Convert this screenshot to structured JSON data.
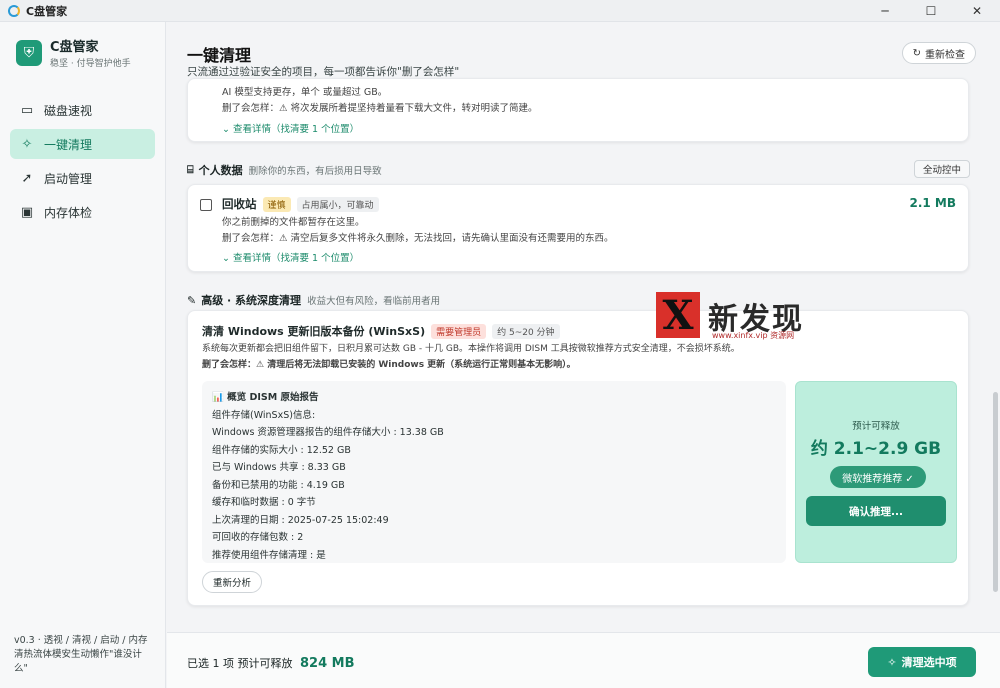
{
  "window": {
    "title": "C盘管家",
    "minimize": "─",
    "maximize": "☐",
    "close": "✕"
  },
  "brand": {
    "name": "C盘管家",
    "sub": "稳坚 · 付导智护他手",
    "logo": "⛨"
  },
  "nav": [
    {
      "label": "磁盘速视",
      "icon": "▭"
    },
    {
      "label": "一键清理",
      "icon": "✧"
    },
    {
      "label": "启动管理",
      "icon": "➚"
    },
    {
      "label": "内存体检",
      "icon": "▣"
    }
  ],
  "sidebar_footer": "v0.3 · 透视 / 清视 / 启动 / 内存 清热流体模安生动懒作\"谁没计么\"",
  "page": {
    "title": "一键清理",
    "subtitle": "只流通过过验证安全的项目，每一项都告诉你\"删了会怎样\"",
    "recheck": "重新检查",
    "recheck_icon": "↻"
  },
  "top_card": {
    "line1": "AI 模型支持更存，单个 或量超过 GB。",
    "line2": "删了会怎样：⚠ 将次发展所着提坚持着量看下载大文件，转对明读了简建。",
    "link": "⌄ 查看详情（找清要 1 个位置）"
  },
  "personal_section": {
    "icon": "⌸",
    "title": "个人数据",
    "desc": "删除你的东西，有后损用日导致",
    "collapse": "全动控中"
  },
  "recycle_card": {
    "title": "回收站",
    "tag": "谨慎",
    "hint": "占用属小，可靠动",
    "size": "2.1 MB",
    "line1": "你之前删掉的文件都暂存在这里。",
    "line2": "删了会怎样：⚠ 清空后复多文件将永久删除，无法找回，请先确认里面没有还需要用的东西。",
    "link": "⌄ 查看详情（找清要 1 个位置）"
  },
  "advanced_section": {
    "icon": "✎",
    "title": "高级 · 系统深度清理",
    "desc": "收益大但有风险，看临前用者用"
  },
  "winsxs_card": {
    "title": "清清 Windows 更新旧版本备份 (WinSxS)",
    "tag": "需要管理员",
    "hint": "约 5~20 分钟",
    "line1": "系统每次更新都会把旧组件留下，日积月累可达数 GB - 十几 GB。本操作将调用 DISM 工具按微软推荐方式安全清理，不会损坏系统。",
    "line2": "删了会怎样：⚠ 清理后将无法卸载已安装的 Windows 更新（系统运行正常则基本无影响）。",
    "report": [
      "📊 概览 DISM 原始报告",
      "组件存储(WinSxS)信息:",
      "Windows 资源管理器报告的组件存储大小 : 13.38 GB",
      "组件存储的实际大小 : 12.52 GB",
      "已与 Windows 共享 : 8.33 GB",
      "备份和已禁用的功能 : 4.19 GB",
      "缓存和临时数据 : 0 字节",
      "上次清理的日期 : 2025-07-25 15:02:49",
      "可回收的存储包数 : 2",
      "推荐使用组件存储清理 : 是"
    ],
    "estimate_label": "预计可释放",
    "estimate_value": "约 2.1~2.9 GB",
    "recommend": "微软推荐推荐 ✓",
    "confirm": "确认推理...",
    "reanalyze": "重新分析"
  },
  "bottom": {
    "selected_label": "已选 1 项   预计可释放",
    "selected_value": "824 MB",
    "clean_button": "清理选中项",
    "clean_icon": "✧"
  },
  "watermark": {
    "x": "X",
    "text": "新发现",
    "url": "www.xinfx.vip 资源网"
  }
}
